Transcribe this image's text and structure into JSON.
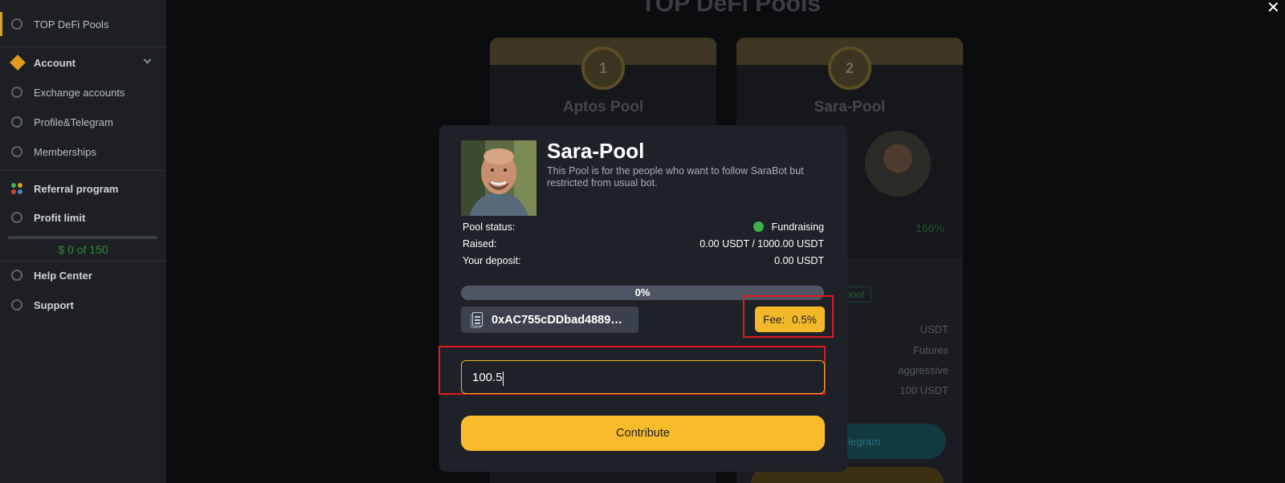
{
  "page": {
    "title": "TOP DeFi Pools",
    "close_symbol": "✕"
  },
  "sidebar": {
    "items": [
      {
        "label": "TOP DeFi Pools",
        "icon": "pools-icon"
      },
      {
        "label": "Account",
        "icon": "account-icon"
      },
      {
        "label": "Exchange accounts",
        "icon": "exchange-icon"
      },
      {
        "label": "Profile&Telegram",
        "icon": "profile-icon"
      },
      {
        "label": "Memberships",
        "icon": "membership-icon"
      },
      {
        "label": "Referral program",
        "icon": "referral-icon"
      },
      {
        "label": "Profit limit",
        "icon": "profit-icon"
      },
      {
        "label": "Help Center",
        "icon": "help-icon"
      },
      {
        "label": "Support",
        "icon": "support-icon"
      }
    ],
    "profit_limit_text": "$ 0 of 150"
  },
  "cards": [
    {
      "rank": "1",
      "name": "Aptos Pool"
    },
    {
      "rank": "2",
      "name": "Sara-Pool",
      "percent": "166%",
      "tag": "pool",
      "rows": [
        "USDT",
        "Futures",
        "aggressive",
        "100 USDT"
      ],
      "row_label_fragment": "e",
      "telegram_button": "elegram"
    }
  ],
  "modal": {
    "title": "Sara-Pool",
    "description": "This Pool is for the people who want to follow SaraBot but restricted from usual bot.",
    "pool_status_label": "Pool status:",
    "pool_status_value": "Fundraising",
    "raised_label": "Raised:",
    "raised_value": "0.00 USDT / 1000.00 USDT",
    "deposit_label": "Your deposit:",
    "deposit_value": "0.00 USDT",
    "progress_percent": 0,
    "progress_text": "0%",
    "address": "0xAC755cDDbad48898…",
    "fee_label": "Fee:",
    "fee_value": "0.5%",
    "amount_value": "100.5",
    "contribute_label": "Contribute",
    "colors": {
      "accent": "#f7bb2c",
      "status_ok": "#3fae4e",
      "highlight": "#e0191f",
      "panel": "#1e2127"
    }
  }
}
